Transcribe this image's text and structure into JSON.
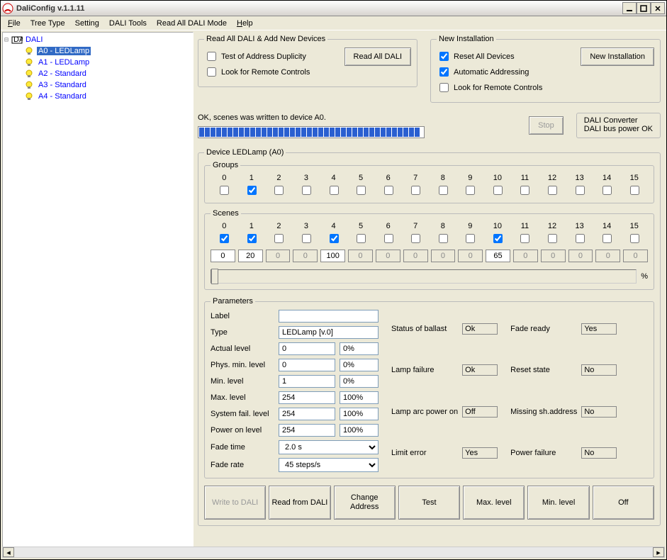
{
  "window": {
    "title": "DaliConfig v.1.1.11"
  },
  "menu": {
    "file": "File",
    "treetype": "Tree Type",
    "setting": "Setting",
    "dalitools": "DALI Tools",
    "readall": "Read All DALI Mode",
    "help": "Help"
  },
  "tree": {
    "root": "DALI",
    "items": [
      {
        "label": "A0 - LEDLamp",
        "selected": true
      },
      {
        "label": "A1 - LEDLamp",
        "selected": false
      },
      {
        "label": "A2 - Standard",
        "selected": false
      },
      {
        "label": "A3 - Standard",
        "selected": false
      },
      {
        "label": "A4 - Standard",
        "selected": false
      }
    ]
  },
  "readall": {
    "legend": "Read All DALI & Add New Devices",
    "test_dup": "Test of Address Duplicity",
    "look_remote": "Look for Remote Controls",
    "btn": "Read All DALI"
  },
  "newinst": {
    "legend": "New Installation",
    "reset": "Reset All Devices",
    "auto": "Automatic Addressing",
    "look_remote": "Look for Remote Controls",
    "btn": "New Installation"
  },
  "status_msg": "OK, scenes was written to device A0.",
  "stop": "Stop",
  "converter": {
    "legend": "DALI Converter",
    "msg": "DALI bus power OK"
  },
  "device": {
    "legend": "Device LEDLamp (A0)",
    "groups_legend": "Groups",
    "scenes_legend": "Scenes",
    "group_checks": [
      false,
      true,
      false,
      false,
      false,
      false,
      false,
      false,
      false,
      false,
      false,
      false,
      false,
      false,
      false,
      false
    ],
    "scene_checks": [
      true,
      true,
      false,
      false,
      true,
      false,
      false,
      false,
      false,
      false,
      true,
      false,
      false,
      false,
      false,
      false
    ],
    "scene_vals": [
      "0",
      "20",
      "0",
      "0",
      "100",
      "0",
      "0",
      "0",
      "0",
      "0",
      "65",
      "0",
      "0",
      "0",
      "0",
      "0"
    ],
    "scene_enabled": [
      true,
      true,
      false,
      false,
      true,
      false,
      false,
      false,
      false,
      false,
      true,
      false,
      false,
      false,
      false,
      false
    ],
    "pct": "%"
  },
  "params": {
    "legend": "Parameters",
    "label_l": "Label",
    "label_v": "",
    "type_l": "Type",
    "type_v": "LEDLamp [v.0]",
    "actual_l": "Actual level",
    "actual_v": "0",
    "actual_p": "0%",
    "phys_l": "Phys. min. level",
    "phys_v": "0",
    "phys_p": "0%",
    "min_l": "Min. level",
    "min_v": "1",
    "min_p": "0%",
    "max_l": "Max. level",
    "max_v": "254",
    "max_p": "100%",
    "sys_l": "System fail. level",
    "sys_v": "254",
    "sys_p": "100%",
    "pon_l": "Power on level",
    "pon_v": "254",
    "pon_p": "100%",
    "ftime_l": "Fade time",
    "ftime_v": "2.0 s",
    "frate_l": "Fade rate",
    "frate_v": "45 steps/s"
  },
  "stat": {
    "ballast_l": "Status of ballast",
    "ballast_v": "Ok",
    "lampfail_l": "Lamp failure",
    "lampfail_v": "Ok",
    "arc_l": "Lamp arc power on",
    "arc_v": "Off",
    "limit_l": "Limit error",
    "limit_v": "Yes",
    "fade_l": "Fade ready",
    "fade_v": "Yes",
    "reset_l": "Reset state",
    "reset_v": "No",
    "miss_l": "Missing sh.address",
    "miss_v": "No",
    "pfail_l": "Power failure",
    "pfail_v": "No"
  },
  "btns": {
    "write": "Write to DALI",
    "read": "Read from DALI",
    "chg": "Change Address",
    "test": "Test",
    "max": "Max. level",
    "min": "Min. level",
    "off": "Off"
  }
}
